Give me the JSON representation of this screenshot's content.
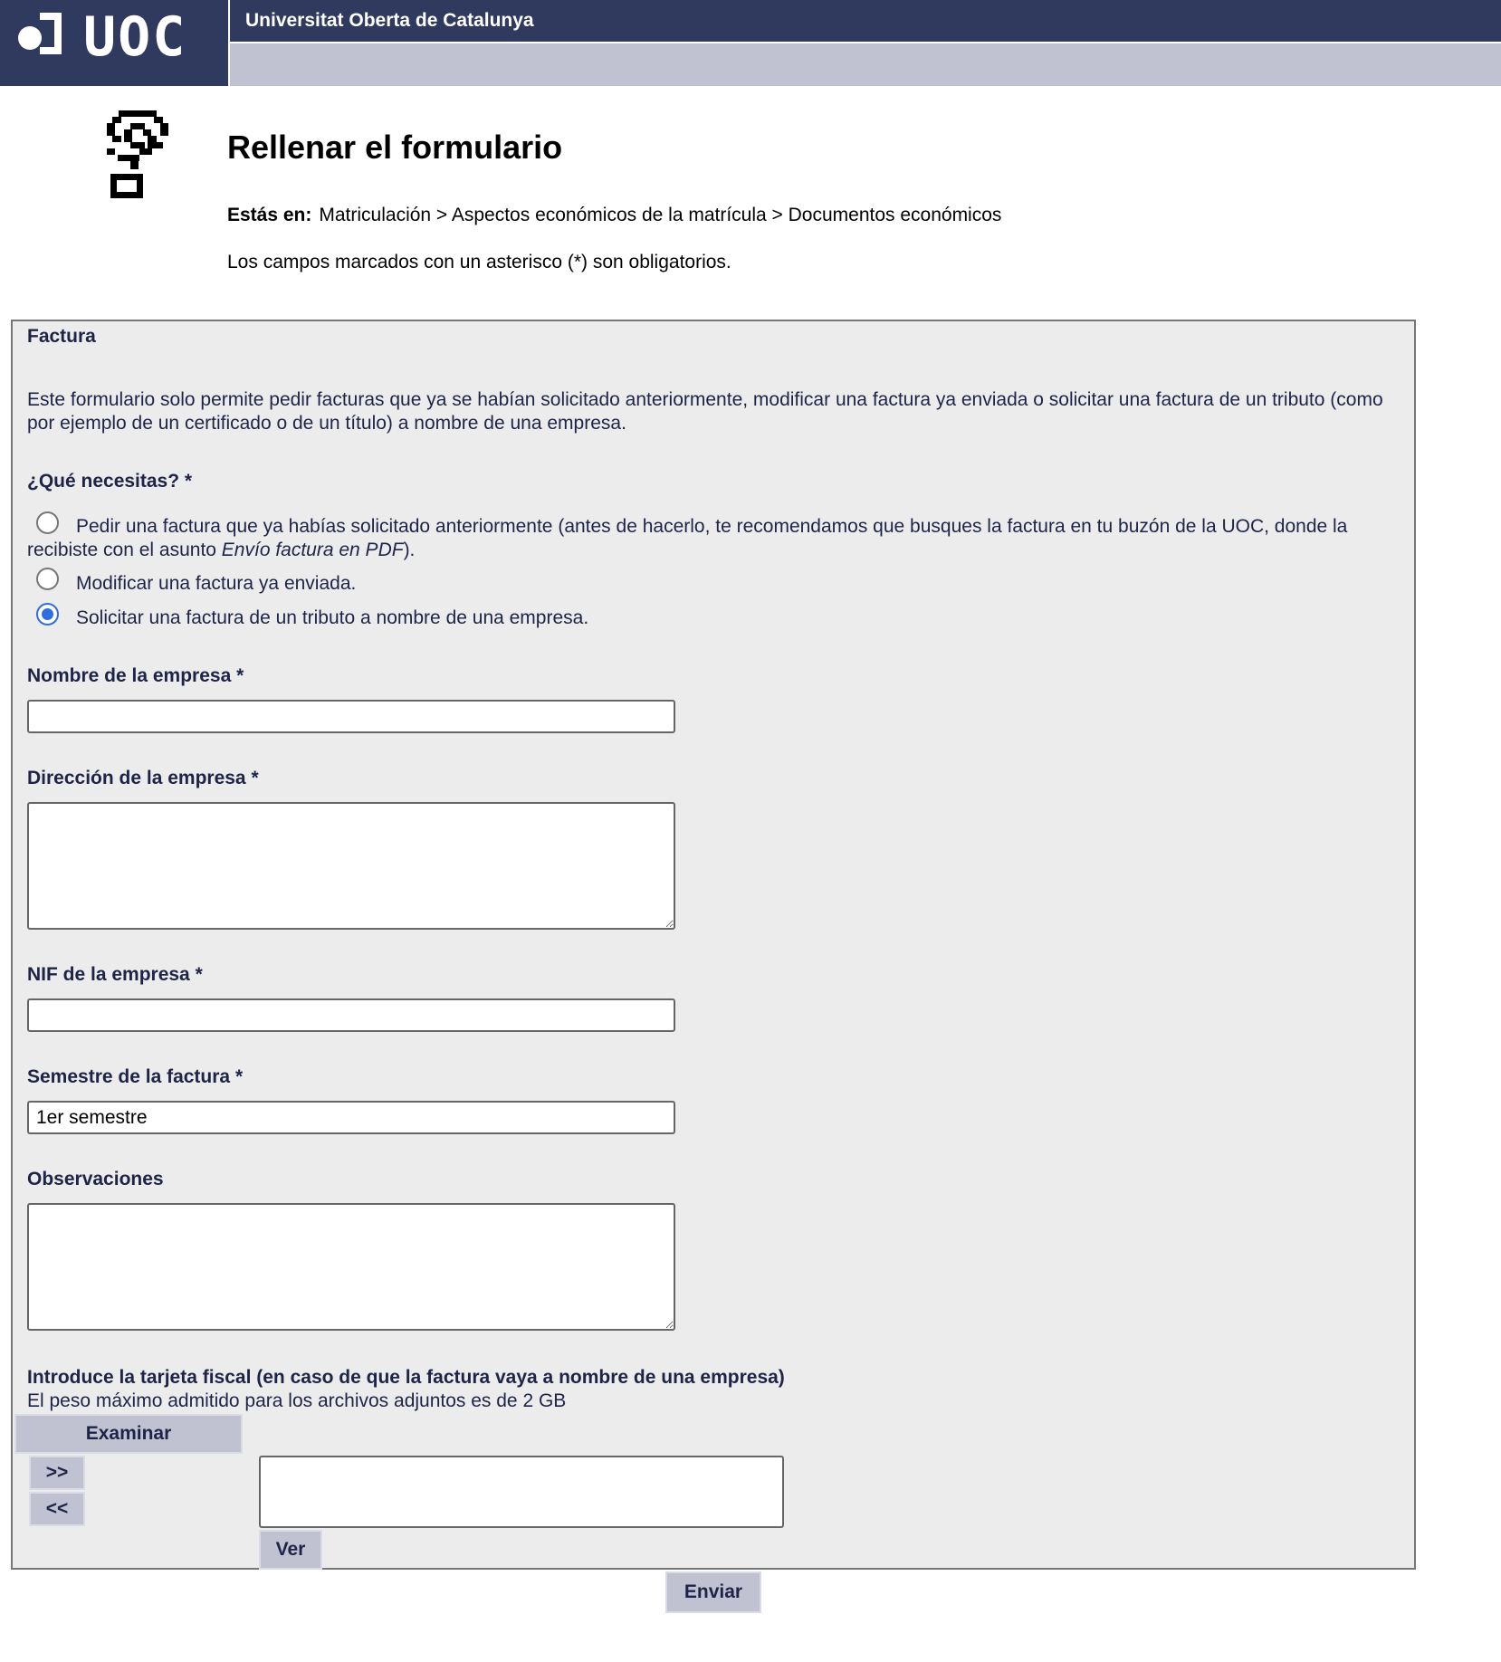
{
  "header": {
    "logo_text": "UOC",
    "title": "Universitat Oberta de Catalunya"
  },
  "page": {
    "title": "Rellenar el formulario",
    "breadcrumb_lead": "Estás en:",
    "breadcrumb_path": "Matriculación > Aspectos económicos de la matrícula > Documentos económicos",
    "required_note": "Los campos marcados con un asterisco (*) son obligatorios."
  },
  "form": {
    "legend": "Factura",
    "description": "Este formulario solo permite pedir facturas que ya se habían solicitado anteriormente, modificar una factura ya enviada o solicitar una factura de un tributo (como por ejemplo de un certificado o de un título) a nombre de una empresa.",
    "need_label": "¿Qué necesitas? *",
    "options": [
      {
        "text_before": "Pedir una factura que ya habías solicitado anteriormente (antes de hacerlo, te recomendamos que busques la factura en tu buzón de la UOC, donde la recibiste con el asunto ",
        "text_italic": "Envío factura en PDF",
        "text_after": ").",
        "selected": false
      },
      {
        "text": "Modificar una factura ya enviada.",
        "selected": false
      },
      {
        "text": "Solicitar una factura de un tributo a nombre de una empresa.",
        "selected": true
      }
    ],
    "company_name_label": "Nombre de la empresa *",
    "company_name_value": "",
    "company_address_label": "Dirección de la empresa *",
    "company_address_value": "",
    "nif_label": "NIF de la empresa *",
    "nif_value": "",
    "semester_label": "Semestre de la factura *",
    "semester_value": "1er semestre",
    "observations_label": "Observaciones",
    "observations_value": "",
    "fiscal_label": "Introduce la tarjeta fiscal (en caso de que la factura vaya a nombre de una empresa)",
    "max_size_note": "El peso máximo admitido para los archivos adjuntos es de 2 GB",
    "browse_label": "Examinar",
    "move_right_label": ">>",
    "move_left_label": "<<",
    "view_label": "Ver"
  },
  "submit_label": "Enviar",
  "colors": {
    "header_navy": "#30395e",
    "header_sub": "#c0c2d1",
    "label_text": "#1e2448",
    "panel_bg": "#ececec",
    "radio_selected": "#2f6de0"
  }
}
